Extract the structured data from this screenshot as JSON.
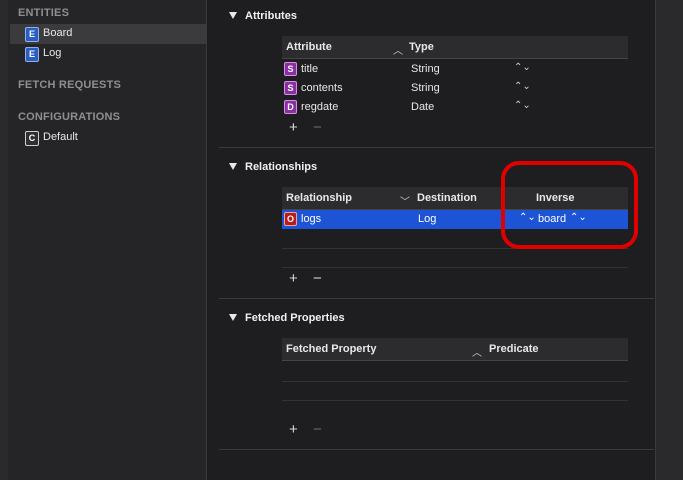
{
  "sidebar": {
    "entities_header": "ENTITIES",
    "entities": [
      {
        "badge": "E",
        "label": "Board"
      },
      {
        "badge": "E",
        "label": "Log"
      }
    ],
    "fetch_requests_header": "FETCH REQUESTS",
    "configurations_header": "CONFIGURATIONS",
    "configurations": [
      {
        "badge": "C",
        "label": "Default"
      }
    ]
  },
  "attributes": {
    "title": "Attributes",
    "col_attribute": "Attribute",
    "col_type": "Type",
    "rows": [
      {
        "badge": "S",
        "name": "title",
        "type": "String"
      },
      {
        "badge": "S",
        "name": "contents",
        "type": "String"
      },
      {
        "badge": "D",
        "name": "regdate",
        "type": "Date"
      }
    ],
    "add": "+",
    "remove": "−"
  },
  "relationships": {
    "title": "Relationships",
    "col_relationship": "Relationship",
    "col_destination": "Destination",
    "col_inverse": "Inverse",
    "rows": [
      {
        "badge": "O",
        "name": "logs",
        "destination": "Log",
        "inverse": "board"
      }
    ],
    "add": "+",
    "remove": "−"
  },
  "fetched_properties": {
    "title": "Fetched Properties",
    "col_fetched_property": "Fetched Property",
    "col_predicate": "Predicate",
    "add": "+",
    "remove": "−"
  },
  "colors": {
    "selection": "#1d54d6",
    "annotation": "#e00000",
    "entity_badge": "#2a5ec0",
    "attribute_badge": "#8a2fa0"
  }
}
